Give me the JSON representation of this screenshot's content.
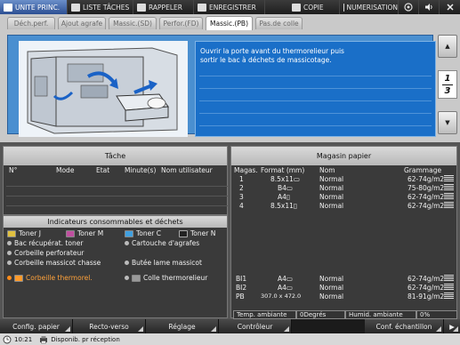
{
  "topbar": {
    "tabs": [
      {
        "label": "UNITE PRINC.",
        "icon": "home-icon",
        "active": true
      },
      {
        "label": "LISTE TÂCHES",
        "icon": "list-icon",
        "active": false
      },
      {
        "label": "RAPPELER",
        "icon": "recall-icon",
        "active": false
      },
      {
        "label": "ENREGISTRER",
        "icon": "save-icon",
        "active": false
      },
      {
        "label": "COPIE",
        "icon": "copy-icon",
        "active": false
      },
      {
        "label": "NUMERISATION",
        "icon": "scan-icon",
        "active": false
      }
    ],
    "utility_icons": [
      "power-icon",
      "volume-icon",
      "exit-icon"
    ]
  },
  "subtabs": [
    {
      "label": "Déch.perf.",
      "active": false
    },
    {
      "label": "Ajout agrafe",
      "active": false
    },
    {
      "label": "Massic.(SD)",
      "active": false
    },
    {
      "label": "Perfor.(FD)",
      "active": false
    },
    {
      "label": "Massic.(PB)",
      "active": true
    },
    {
      "label": "Pas.de colle",
      "active": false
    }
  ],
  "message": {
    "line1": "Ouvrir la porte avant du thermorelieur puis",
    "line2": "sortir le bac à déchets de massicotage."
  },
  "pager": {
    "current": "1",
    "total": "3"
  },
  "job": {
    "title": "Tâche",
    "columns": [
      "N°",
      "Mode",
      "Etat",
      "Minute(s)",
      "Nom utilisateur"
    ]
  },
  "supplies": {
    "title": "Indicateurs consommables et déchets",
    "items": [
      {
        "label": "Toner J",
        "warn": false
      },
      {
        "label": "Toner M",
        "warn": false
      },
      {
        "label": "Toner C",
        "warn": false
      },
      {
        "label": "Toner N",
        "warn": false
      },
      {
        "label": "Bac récupérat. toner",
        "warn": false
      },
      {
        "label": "Cartouche d'agrafes",
        "warn": false
      },
      {
        "label": "Corbeille perforateur",
        "warn": false
      },
      {
        "label": "Corbeille massicot chasse",
        "warn": false
      },
      {
        "label": "Butée lame massicot",
        "warn": false
      },
      {
        "label": "Corbeille thermorel.",
        "warn": true
      },
      {
        "label": "Colle thermorelieur",
        "warn": false
      }
    ]
  },
  "paper": {
    "title": "Magasin papier",
    "columns": [
      "Magas.",
      "Format (mm)",
      "Nom",
      "Grammage"
    ],
    "trays": [
      {
        "tray": "1",
        "size": "8.5x11▭",
        "name": "Normal",
        "weight": "62-74g/m2"
      },
      {
        "tray": "2",
        "size": "B4▭",
        "name": "Normal",
        "weight": "75-80g/m2"
      },
      {
        "tray": "3",
        "size": "A4▯",
        "name": "Normal",
        "weight": "62-74g/m2"
      },
      {
        "tray": "4",
        "size": "8.5x11▯",
        "name": "Normal",
        "weight": "62-74g/m2"
      },
      {
        "tray": "BI1",
        "size": "A4▭",
        "name": "Normal",
        "weight": "62-74g/m2"
      },
      {
        "tray": "BI2",
        "size": "A4▭",
        "name": "Normal",
        "weight": "62-74g/m2"
      },
      {
        "tray": "PB",
        "size": "307.0 x 472.0",
        "name": "Normal",
        "weight": "81-91g/m2"
      }
    ],
    "ambient_temp_label": "Temp. ambiante",
    "ambient_temp_value": "0Degrés",
    "ambient_hum_label": "Humid. ambiante",
    "ambient_hum_value": "0%"
  },
  "footer": {
    "buttons": [
      "Config. papier",
      "Recto-verso",
      "Réglage",
      "Contrôleur",
      "Conf. échantillon"
    ]
  },
  "status": {
    "time": "10:21",
    "text": "Disponib. pr réception"
  }
}
